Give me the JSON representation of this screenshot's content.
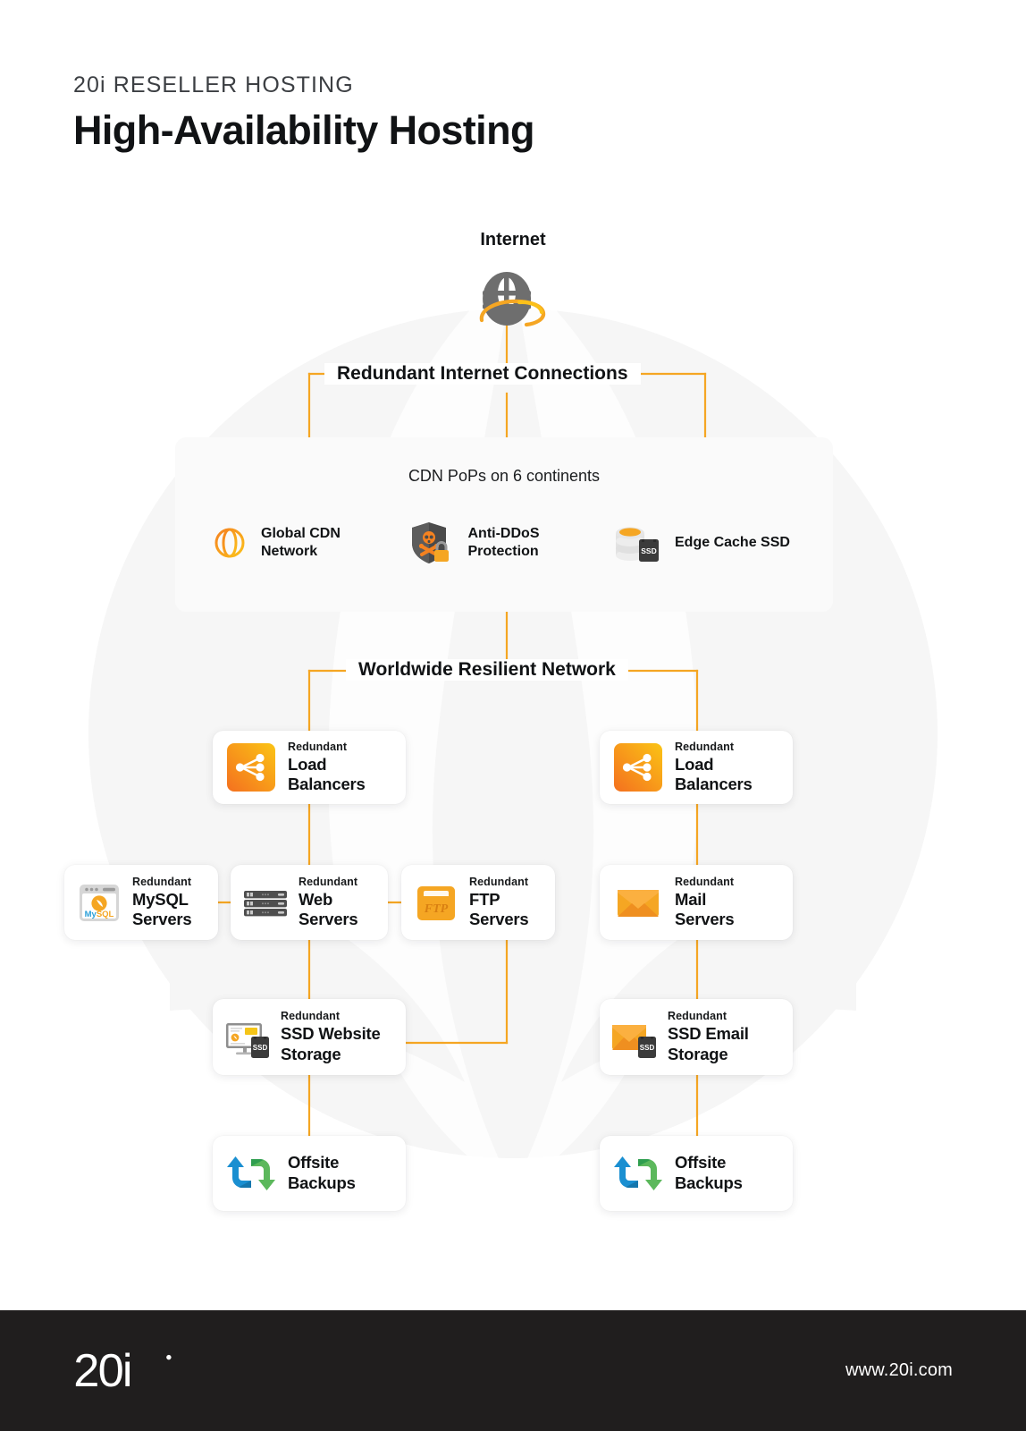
{
  "header": {
    "eyebrow": "20i RESELLER HOSTING",
    "title": "High-Availability Hosting"
  },
  "diagram": {
    "internet_label": "Internet",
    "internet_icon": "globe-orbit-icon",
    "band_redundant_internet": "Redundant Internet Connections",
    "band_worldwide_network": "Worldwide Resilient Network",
    "cdn_panel": {
      "heading": "CDN PoPs on 6 continents",
      "items": [
        {
          "icon": "global-cdn-globe-icon",
          "label": "Global CDN\nNetwork"
        },
        {
          "icon": "anti-ddos-shield-icon",
          "label": "Anti-DDoS\nProtection"
        },
        {
          "icon": "edge-cache-ssd-icon",
          "label": "Edge\nCache SSD"
        }
      ]
    },
    "nodes": {
      "load_balancer_left": {
        "icon": "load-balancer-icon",
        "kicker": "Redundant",
        "title": "Load\nBalancers"
      },
      "load_balancer_right": {
        "icon": "load-balancer-icon",
        "kicker": "Redundant",
        "title": "Load\nBalancers"
      },
      "mysql_servers": {
        "icon": "mysql-icon",
        "kicker": "Redundant",
        "title": "MySQL\nServers"
      },
      "web_servers": {
        "icon": "server-rack-icon",
        "kicker": "Redundant",
        "title": "Web\nServers"
      },
      "ftp_servers": {
        "icon": "ftp-folder-icon",
        "kicker": "Redundant",
        "title": "FTP\nServers"
      },
      "mail_servers": {
        "icon": "envelope-icon",
        "kicker": "Redundant",
        "title": "Mail\nServers"
      },
      "ssd_website_storage": {
        "icon": "monitor-ssd-icon",
        "kicker": "Redundant",
        "title": "SSD Website\nStorage"
      },
      "ssd_email_storage": {
        "icon": "envelope-ssd-icon",
        "kicker": "Redundant",
        "title": "SSD Email\nStorage"
      },
      "offsite_backups_left": {
        "icon": "sync-arrows-icon",
        "kicker": "",
        "title": "Offsite\nBackups"
      },
      "offsite_backups_right": {
        "icon": "sync-arrows-icon",
        "kicker": "",
        "title": "Offsite\nBackups"
      }
    }
  },
  "footer": {
    "logo": "20i",
    "logo_mark": "20i-logo",
    "url": "www.20i.com"
  },
  "colors": {
    "accent_orange": "#f5a623",
    "connector": "#f5a623",
    "orange_deep": "#f58220",
    "yellow": "#fbc01a",
    "dark": "#201e1e",
    "panel_bg": "#fafafa",
    "text": "#111315"
  }
}
